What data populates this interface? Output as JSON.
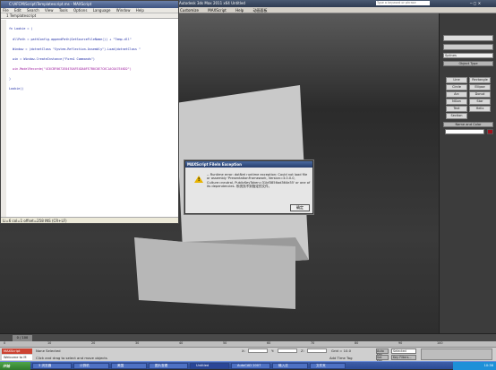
{
  "max": {
    "title": "Autodesk 3ds Max 2011 x64    Untitled",
    "search_placeholder": "Type a keyword or phrase",
    "menus": [
      "Customize",
      "MAXScript",
      "Help",
      "动画面板"
    ]
  },
  "editor": {
    "title": "C:\\AFCM\\Script\\Templatescript.ms - MAXScript",
    "menus": [
      "File",
      "Edit",
      "Search",
      "View",
      "Tools",
      "Options",
      "Language",
      "Window",
      "Help"
    ],
    "tab": "1 Templatescript",
    "code_lines": [
      "fn Lookie = (",
      "  dllPath = pathConfig.appendPath(GetSourceFileName()) + \"Temp.dll\"",
      "  Window = (dotnetClass \"System.Reflection.Assembly\").Load(dotnetClass \"",
      "  win = Window.CreateInstance(\"Form1 Commands\")",
      "  win.ModelRecorde(\"4C6CBF0672E0470AFE4DA0FE7B0C0E7C6C1AC6A7E46D2\")",
      ")",
      "Lookie()"
    ],
    "status": "Li=6 col=1 offset=258 INS (CR+LF)"
  },
  "dialog": {
    "title": "MAXScript FileIn Exception",
    "message": "-- Runtime error: dotNet runtime exception: Could not load file or assembly 'PresentationFramework, Version=3.0.0.0, Culture=neutral, PublicKeyToken=31bf3856ad364e35' or one of its dependencies. 系统找不到指定的文件。",
    "ok_label": "确定"
  },
  "command_panel": {
    "dropdown": "Splines",
    "rollout_object_type": "Object Type",
    "buttons": [
      "Line",
      "Rectangle",
      "Circle",
      "Ellipse",
      "Arc",
      "Donut",
      "NGon",
      "Star",
      "Text",
      "Helix",
      "Section"
    ],
    "rollout_name_color": "Name and Color"
  },
  "timeline": {
    "frame_display": "0 / 100",
    "ticks": [
      "0",
      "10",
      "20",
      "30",
      "40",
      "50",
      "60",
      "70",
      "80",
      "90",
      "100"
    ]
  },
  "status": {
    "selection": "None Selected",
    "prompt": "Click and drag to select and move objects",
    "maxscript_label": "MAXScript",
    "welcome": "Welcome to M",
    "x_label": "X:",
    "y_label": "Y:",
    "z_label": "Z:",
    "grid": "Grid = 10.0",
    "auto_key": "Auto Key",
    "selected_dropdown": "Selected",
    "set_key": "Set Key",
    "key_filters": "Key Filters...",
    "add_time_tag": "Add Time Tag"
  },
  "taskbar": {
    "start_label": "开始",
    "tasks": [
      "3 浏览器",
      "计算机",
      "美国",
      "图片查看",
      "Untitled",
      "AutoCAD 2007",
      "输入法",
      "文件夹"
    ],
    "clock": "10:36"
  },
  "colors": {
    "accent_blue": "#2a4a95",
    "warning_yellow": "#e8b400",
    "code_blue": "#1c2aa5",
    "string_purple": "#a020a0",
    "color_swatch": "#a0141e"
  }
}
